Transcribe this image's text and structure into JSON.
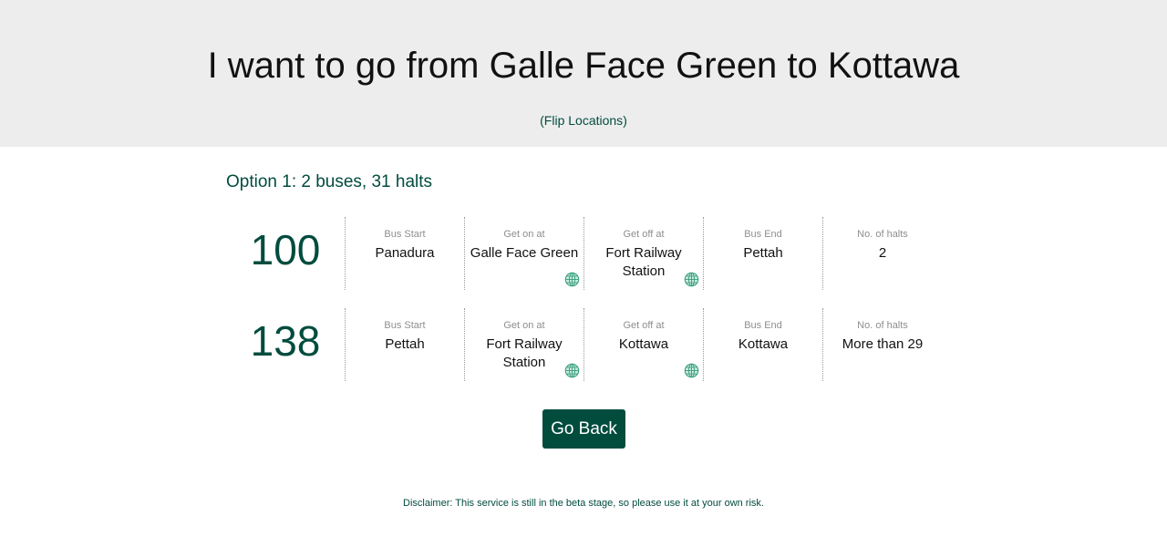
{
  "header": {
    "title": "I want to go from Galle Face Green to Kottawa",
    "flip_open": "(",
    "flip_label": "Flip Locations",
    "flip_close": ")"
  },
  "option": {
    "title": "Option 1: 2 buses, 31 halts"
  },
  "columns": [
    "Bus Start",
    "Get on at",
    "Get off at",
    "Bus End",
    "No. of halts"
  ],
  "routes": [
    {
      "bus_number": "100",
      "bus_start": "Panadura",
      "get_on_at": "Galle Face Green",
      "get_off_at": "Fort Railway Station",
      "bus_end": "Pettah",
      "halts": "2"
    },
    {
      "bus_number": "138",
      "bus_start": "Pettah",
      "get_on_at": "Fort Railway Station",
      "get_off_at": "Kottawa",
      "bus_end": "Kottawa",
      "halts": "More than 29"
    }
  ],
  "icons": {
    "map_link": "globe-icon"
  },
  "actions": {
    "go_back_label": "Go Back"
  },
  "footer": {
    "disclaimer": "Disclaimer: This service is still in the beta stage, so please use it at your own risk."
  },
  "colors": {
    "accent": "#024c3e",
    "hero_bg": "#ededed",
    "label_gray": "#8e8e8e",
    "globe": "#3aa07f"
  }
}
